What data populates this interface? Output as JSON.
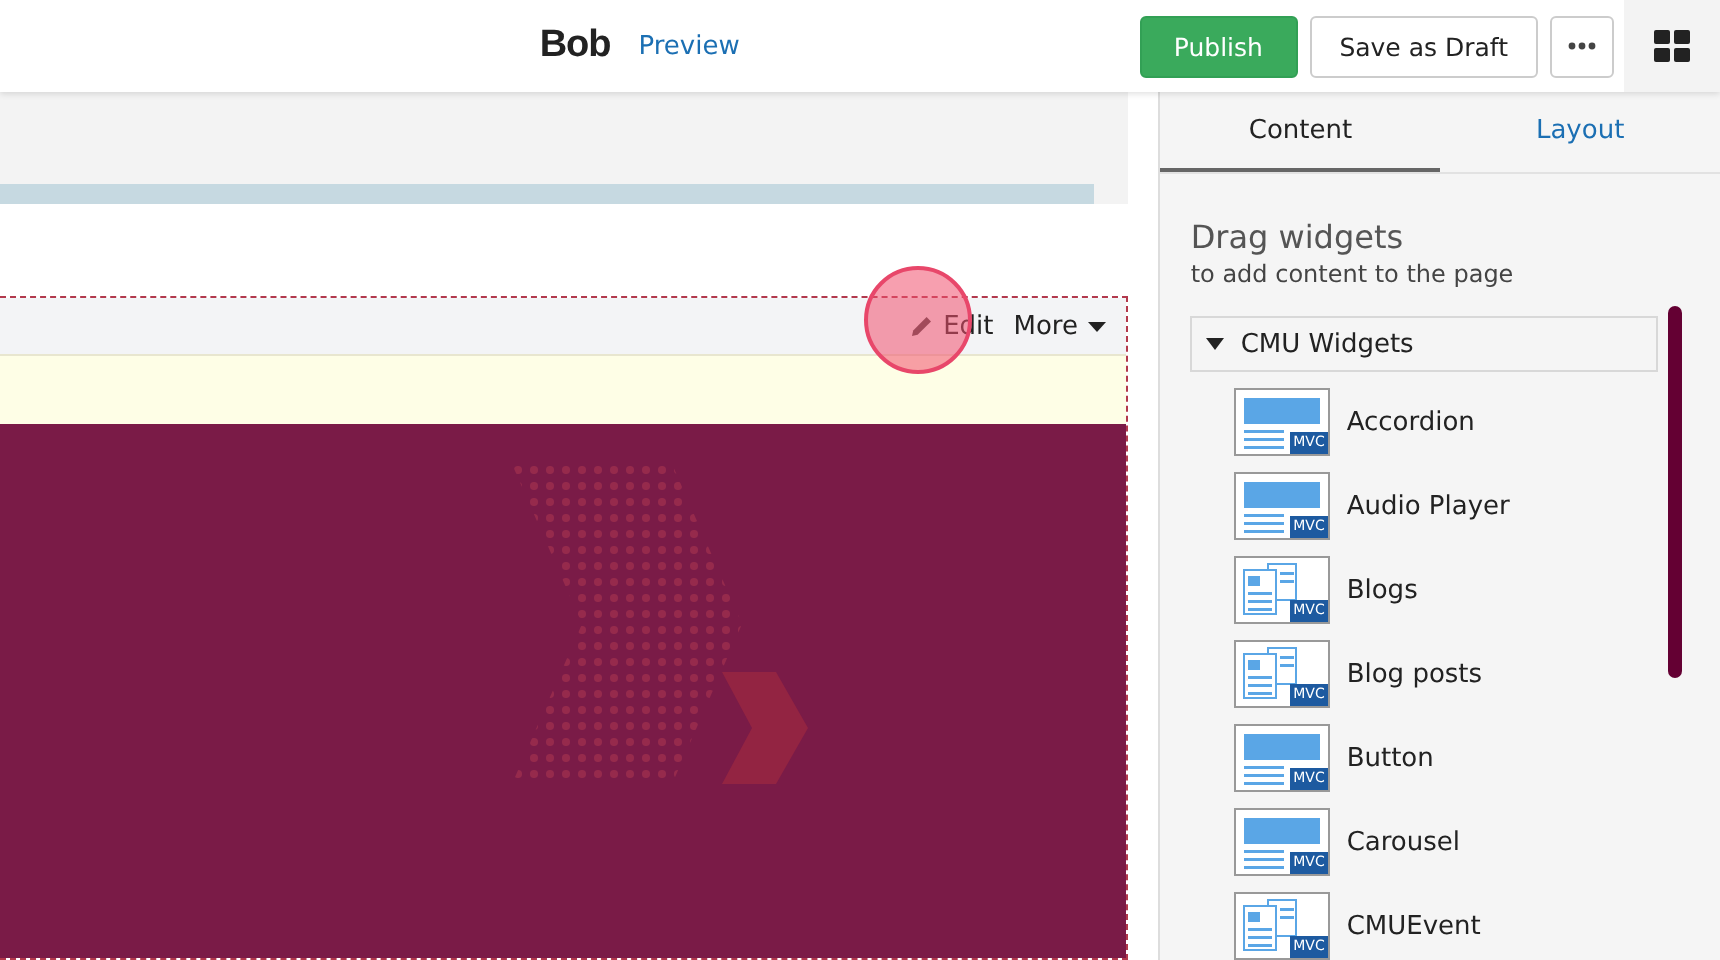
{
  "header": {
    "title": "Bob",
    "preview_link": "Preview",
    "buttons": [
      {
        "label": "Publish",
        "kind": "primary"
      },
      {
        "label": "Save as Draft",
        "kind": "default"
      }
    ]
  },
  "widget_toolbar": {
    "edit": "Edit",
    "more": "More"
  },
  "tabs": [
    {
      "label": "Content",
      "selected": true
    },
    {
      "label": "Layout",
      "selected": false
    }
  ],
  "panel": {
    "heading": "Drag widgets",
    "subheading": "to add content to the page",
    "group": {
      "label": "CMU Widgets",
      "expanded": true,
      "items": [
        {
          "label": "Accordion",
          "kind": "banner",
          "badge": "MVC"
        },
        {
          "label": "Audio Player",
          "kind": "banner",
          "badge": "MVC"
        },
        {
          "label": "Blogs",
          "kind": "list",
          "badge": "MVC"
        },
        {
          "label": "Blog posts",
          "kind": "list",
          "badge": "MVC"
        },
        {
          "label": "Button",
          "kind": "banner",
          "badge": "MVC"
        },
        {
          "label": "Carousel",
          "kind": "banner",
          "badge": "MVC"
        },
        {
          "label": "CMUEvent",
          "kind": "list",
          "badge": "MVC"
        }
      ]
    }
  }
}
